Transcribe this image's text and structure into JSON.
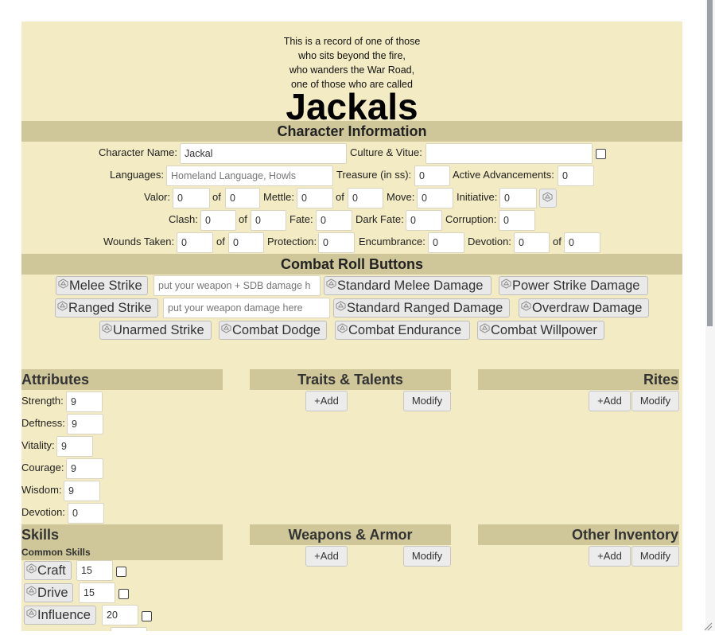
{
  "intro": {
    "line1": "This is a record of one of those",
    "line2": "who sits beyond the fire,",
    "line3": "who wanders the War Road,",
    "line4": "one of those who are called",
    "title": "Jackals"
  },
  "character_info": {
    "heading": "Character Information",
    "character_name_label": "Character Name:",
    "character_name_value": "Jackal",
    "culture_label": "Culture & Vitue:",
    "culture_value": "",
    "languages_label": "Languages:",
    "languages_placeholder": "Homeland Language, Howls",
    "treasure_label": "Treasure (in ss):",
    "treasure_value": "0",
    "advancements_label": "Active Advancements:",
    "advancements_value": "0",
    "valor_label": "Valor:",
    "valor_value": "0",
    "valor_max": "0",
    "mettle_label": "Mettle:",
    "mettle_value": "0",
    "mettle_max": "0",
    "move_label": "Move:",
    "move_value": "0",
    "initiative_label": "Initiative:",
    "initiative_value": "0",
    "clash_label": "Clash:",
    "clash_value": "0",
    "clash_max": "0",
    "fate_label": "Fate:",
    "fate_value": "0",
    "dark_fate_label": "Dark Fate:",
    "dark_fate_value": "0",
    "corruption_label": "Corruption:",
    "corruption_value": "0",
    "wounds_label": "Wounds Taken:",
    "wounds_value": "0",
    "wounds_max": "0",
    "protection_label": "Protection:",
    "protection_value": "0",
    "encumbrance_label": "Encumbrance:",
    "encumbrance_value": "0",
    "devotion_label": "Devotion:",
    "devotion_value": "0",
    "devotion_max": "0",
    "of_label": "of"
  },
  "combat": {
    "heading": "Combat Roll Buttons",
    "melee_strike": "Melee Strike",
    "melee_placeholder": "put your weapon + SDB damage h",
    "standard_melee_damage": "Standard Melee Damage",
    "power_strike_damage": "Power Strike Damage",
    "ranged_strike": "Ranged Strike",
    "ranged_placeholder": "put your weapon damage here",
    "standard_ranged_damage": "Standard Ranged Damage",
    "overdraw_damage": "Overdraw Damage",
    "unarmed_strike": "Unarmed Strike",
    "combat_dodge": "Combat Dodge",
    "combat_endurance": "Combat Endurance",
    "combat_willpower": "Combat Willpower"
  },
  "attributes": {
    "heading": "Attributes",
    "items": [
      {
        "label": "Strength:",
        "value": "9"
      },
      {
        "label": "Deftness:",
        "value": "9"
      },
      {
        "label": "Vitality:",
        "value": "9"
      },
      {
        "label": "Courage:",
        "value": "9"
      },
      {
        "label": "Wisdom:",
        "value": "9"
      },
      {
        "label": "Devotion:",
        "value": "0"
      }
    ]
  },
  "traits": {
    "heading": "Traits & Talents",
    "add": "+Add",
    "modify": "Modify"
  },
  "rites": {
    "heading": "Rites",
    "add": "+Add",
    "modify": "Modify"
  },
  "skills": {
    "heading": "Skills",
    "subheading": "Common Skills",
    "items": [
      {
        "label": "Craft",
        "value": "15"
      },
      {
        "label": "Drive",
        "value": "15"
      },
      {
        "label": "Influence",
        "value": "20"
      }
    ]
  },
  "weapons": {
    "heading": "Weapons & Armor",
    "add": "+Add",
    "modify": "Modify"
  },
  "inventory": {
    "heading": "Other Inventory",
    "add": "+Add",
    "modify": "Modify"
  },
  "colors": {
    "parchment": "#f3ebc3",
    "band": "#cfc69a",
    "button": "#e9e9e9"
  }
}
